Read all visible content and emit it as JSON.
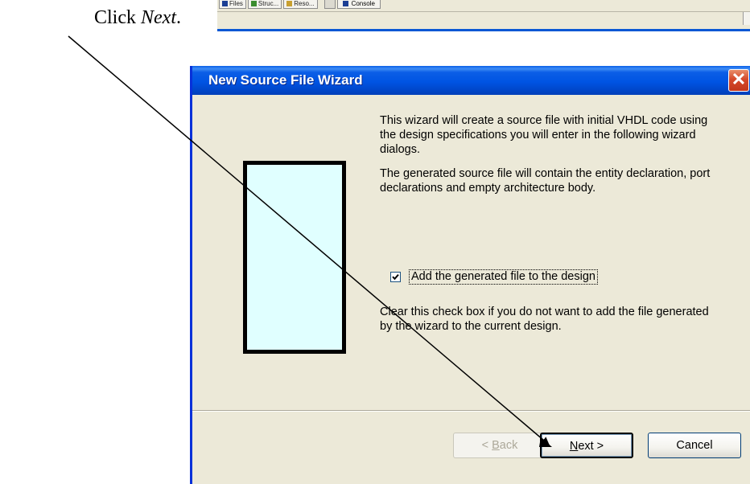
{
  "instruction": {
    "prefix": "Click ",
    "emphasis": "Next",
    "suffix": "."
  },
  "ide": {
    "tabs": [
      "Files",
      "Struc...",
      "Reso..."
    ],
    "console_tab": "Console"
  },
  "wizard": {
    "title": "New Source File Wizard",
    "close_glyph": "✕",
    "paragraph1": "This wizard will create a source file with initial VHDL code using the design specifications you will enter in the following wizard dialogs.",
    "paragraph2": "The generated source file will contain the entity declaration, port declarations and empty architecture body.",
    "checkbox": {
      "label": "Add the generated file to the design",
      "checked": true
    },
    "paragraph3": "Clear this check box if you do not want to add the file generated by the wizard to the current design.",
    "buttons": {
      "back": {
        "label_pre": "< ",
        "label_mnemonic": "B",
        "label_post": "ack",
        "enabled": false
      },
      "next": {
        "label_mnemonic": "N",
        "label_post": "ext >"
      },
      "cancel": "Cancel"
    }
  },
  "colors": {
    "titlebar": "#0054e3",
    "illustration_fill": "#e0ffff",
    "dialog_bg": "#ece9d8"
  }
}
